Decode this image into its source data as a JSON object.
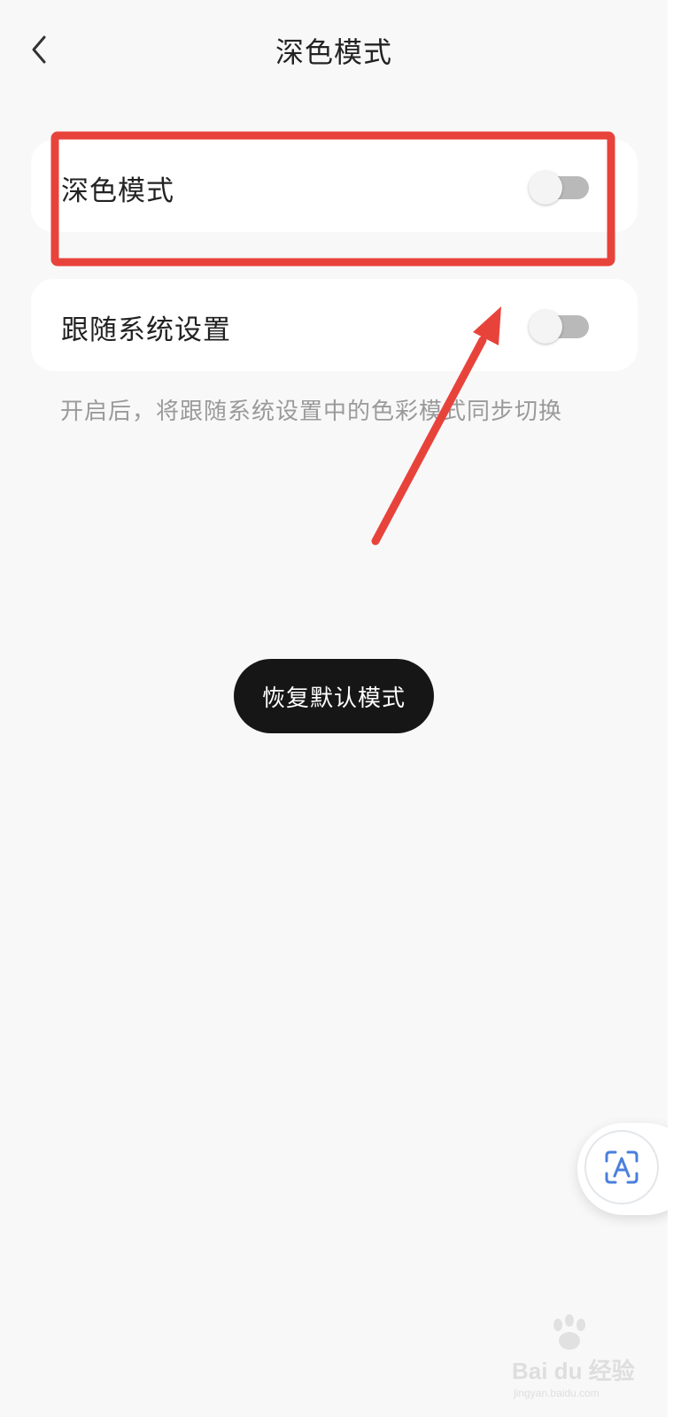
{
  "header": {
    "title": "深色模式",
    "back_icon": "chevron-left-icon"
  },
  "settings": [
    {
      "label": "深色模式",
      "enabled": false
    },
    {
      "label": "跟随系统设置",
      "enabled": false
    }
  ],
  "hint": "开启后，将跟随系统设置中的色彩模式同步切换",
  "restore_button": "恢复默认模式",
  "float_button_icon": "text-scan-icon",
  "annotation": {
    "highlight_color": "#e8433b",
    "arrow_color": "#e8433b"
  },
  "watermark": {
    "brand": "Bai du 经验",
    "url": "jingyan.baidu.com"
  }
}
